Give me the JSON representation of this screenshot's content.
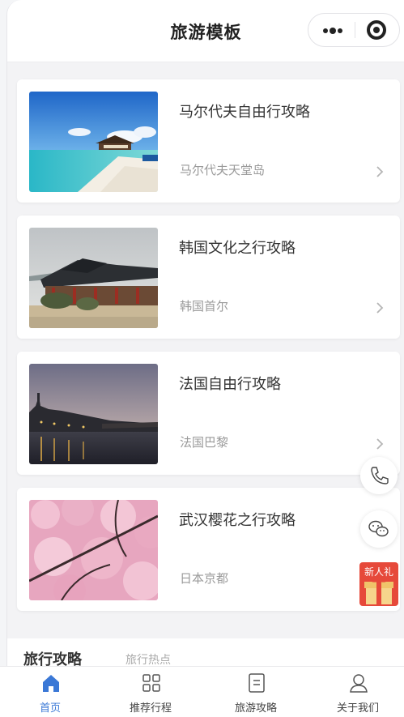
{
  "header": {
    "title": "旅游模板"
  },
  "capsule": {
    "more_icon": "more-dots-icon",
    "close_icon": "target-close-icon"
  },
  "cards": [
    {
      "title": "马尔代夫自由行攻略",
      "subtitle": "马尔代夫天堂岛",
      "image": "maldives-beach-photo"
    },
    {
      "title": "韩国文化之行攻略",
      "subtitle": "韩国首尔",
      "image": "korean-palace-photo"
    },
    {
      "title": "法国自由行攻略",
      "subtitle": "法国巴黎",
      "image": "paris-river-night-photo"
    },
    {
      "title": "武汉樱花之行攻略",
      "subtitle": "日本京都",
      "image": "cherry-blossom-photo"
    }
  ],
  "section": {
    "title": "旅行攻略",
    "tab": "旅行热点"
  },
  "floating": {
    "phone_icon": "phone-icon",
    "wechat_icon": "wechat-icon",
    "gift_label": "新人礼"
  },
  "tabbar": [
    {
      "label": "首页",
      "icon": "home-icon",
      "active": true
    },
    {
      "label": "推荐行程",
      "icon": "grid-icon",
      "active": false
    },
    {
      "label": "旅游攻略",
      "icon": "document-icon",
      "active": false
    },
    {
      "label": "关于我们",
      "icon": "user-icon",
      "active": false
    }
  ],
  "colors": {
    "accent": "#3a78d6",
    "gift": "#e6493a"
  }
}
